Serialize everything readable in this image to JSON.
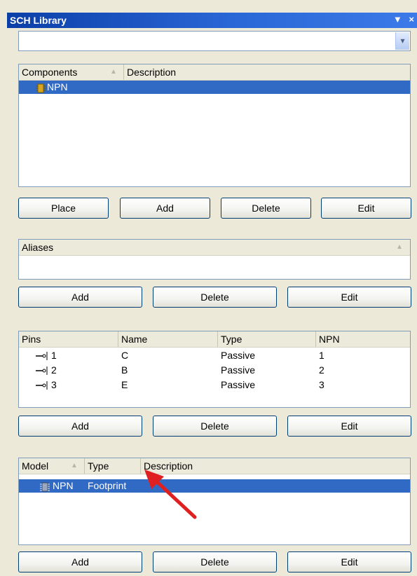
{
  "title": "SCH Library",
  "title_icons": {
    "menu": "▼",
    "close": "×"
  },
  "dropdown": {
    "value": "",
    "arrow": "▾"
  },
  "components": {
    "headers": [
      "Components",
      "Description"
    ],
    "rows": [
      {
        "name": "NPN",
        "description": ""
      }
    ],
    "buttons": {
      "place": "Place",
      "add": "Add",
      "delete": "Delete",
      "edit": "Edit"
    }
  },
  "aliases": {
    "header": "Aliases",
    "rows": [],
    "buttons": {
      "add": "Add",
      "delete": "Delete",
      "edit": "Edit"
    }
  },
  "pins": {
    "headers": [
      "Pins",
      "Name",
      "Type",
      "NPN"
    ],
    "rows": [
      {
        "pin": "1",
        "name": "C",
        "type": "Passive",
        "npn": "1"
      },
      {
        "pin": "2",
        "name": "B",
        "type": "Passive",
        "npn": "2"
      },
      {
        "pin": "3",
        "name": "E",
        "type": "Passive",
        "npn": "3"
      }
    ],
    "buttons": {
      "add": "Add",
      "delete": "Delete",
      "edit": "Edit"
    }
  },
  "models": {
    "headers": [
      "Model",
      "Type",
      "Description"
    ],
    "rows": [
      {
        "model": "NPN",
        "type": "Footprint",
        "description": ""
      }
    ],
    "buttons": {
      "add": "Add",
      "delete": "Delete",
      "edit": "Edit"
    }
  },
  "colors": {
    "selection": "#316ac5",
    "titlebar": "#2a67d6",
    "arrow": "#e02020"
  }
}
